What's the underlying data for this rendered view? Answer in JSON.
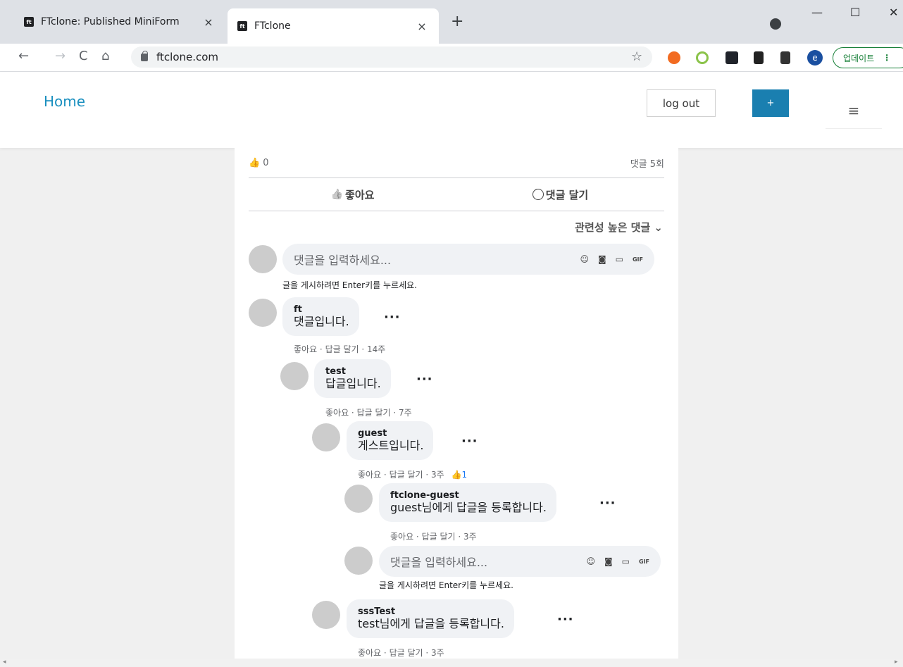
{
  "browser": {
    "tabs": [
      {
        "favicon": "ft",
        "title": "FTclone: Published MiniForm",
        "close": "×"
      },
      {
        "favicon": "ft",
        "title": "FTclone",
        "close": "×"
      }
    ],
    "new_tab": "+",
    "window_controls": {
      "minimize": "—",
      "maximize": "☐",
      "close": "✕"
    },
    "nav": {
      "back": "←",
      "forward": "→",
      "reload": "C",
      "home": "⌂"
    },
    "url": "ftclone.com",
    "bookmark_icon": "☆",
    "profile_initial": "e",
    "update_label": "업데이트",
    "menu_dots": "⋮"
  },
  "header": {
    "home_label": "Home",
    "logout_label": "log out",
    "plus_label": "+",
    "menu_icon": "≡"
  },
  "post": {
    "like_icon": "👍",
    "like_count": "0",
    "comment_count_label": "댓글 5회",
    "like_button_label": "좋아요",
    "comment_button_label": "댓글 달기",
    "sort_label": "관련성 높은 댓글 ⌄"
  },
  "composer": {
    "placeholder": "댓글을 입력하세요...",
    "hint": "글을 게시하려면 Enter키를 누르세요.",
    "icons": {
      "emoji": "☺",
      "camera": "◙",
      "video": "▭",
      "gif": "GIF"
    }
  },
  "comments": [
    {
      "author": "ft",
      "text": "댓글입니다.",
      "meta": "좋아요 · 답글 달기 · 14주",
      "likes": ""
    },
    {
      "author": "test",
      "text": "답글입니다.",
      "meta": "좋아요 · 답글 달기 · 7주",
      "likes": ""
    },
    {
      "author": "guest",
      "text": "게스트입니다.",
      "meta": "좋아요 · 답글 달기 · 3주",
      "likes": "1"
    },
    {
      "author": "ftclone-guest",
      "text": "guest님에게 답글을 등록합니다.",
      "meta": "좋아요 · 답글 달기 · 3주",
      "likes": ""
    },
    {
      "author": "sssTest",
      "text": "test님에게 답글을 등록합니다.",
      "meta": "좋아요 · 답글 달기 · 3주",
      "likes": ""
    }
  ],
  "more_label": "···",
  "colors": {
    "accent": "#1a8fbf",
    "button": "#1a7fb0",
    "like_blue": "#1877f2",
    "bubble": "#f0f2f5"
  }
}
